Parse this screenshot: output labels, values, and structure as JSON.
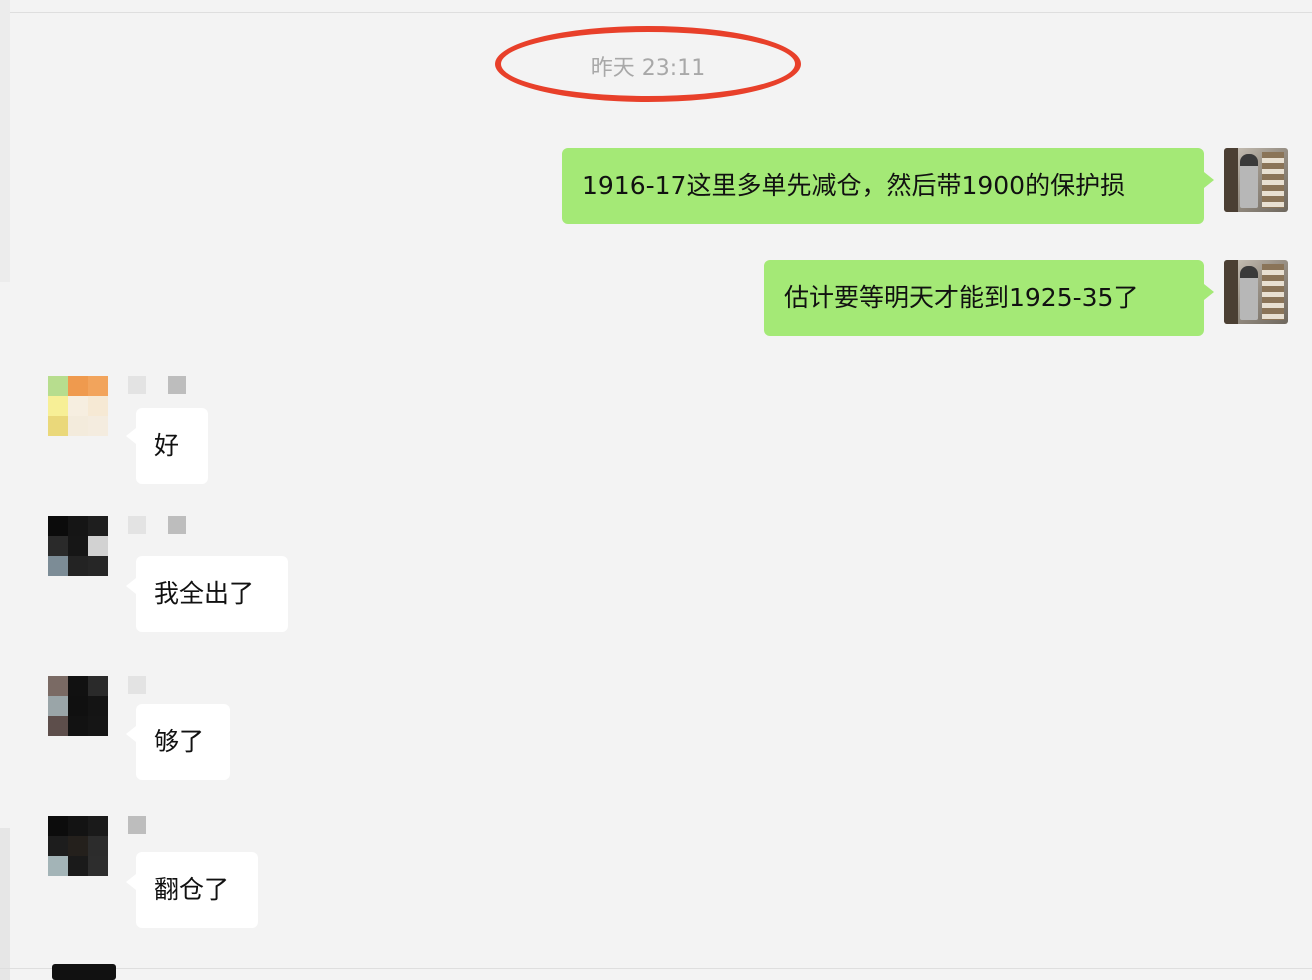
{
  "timestamp": "昨天 23:11",
  "messages": [
    {
      "direction": "out",
      "text": "1916-17这里多单先减仓，然后带1900的保护损"
    },
    {
      "direction": "out",
      "text": "估计要等明天才能到1925-35了"
    },
    {
      "direction": "in",
      "text": "好"
    },
    {
      "direction": "in",
      "text": "我全出了"
    },
    {
      "direction": "in",
      "text": "够了"
    },
    {
      "direction": "in",
      "text": "翻仓了"
    }
  ]
}
